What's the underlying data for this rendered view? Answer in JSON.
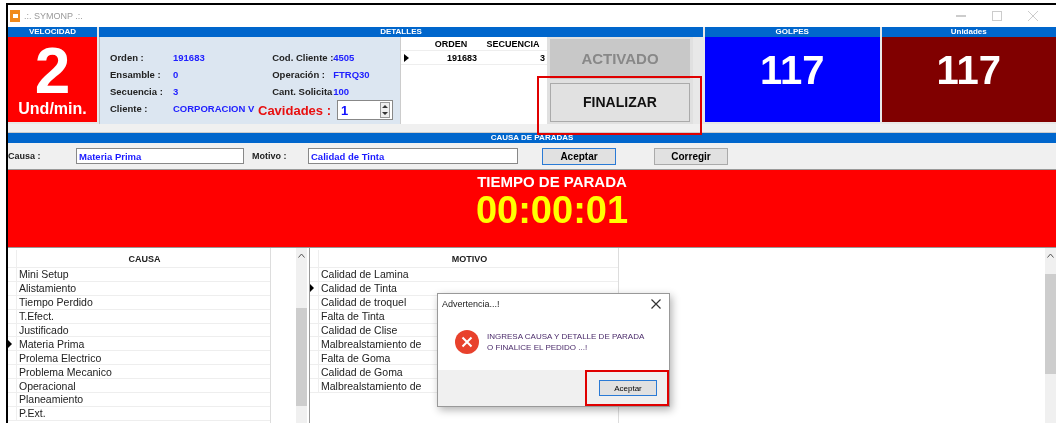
{
  "window": {
    "title": ".:. SYMONP .:."
  },
  "velocidad": {
    "header": "VELOCIDAD",
    "value": "2",
    "unit": "Und/min."
  },
  "detalles": {
    "header": "DETALLES",
    "left_fields": [
      {
        "label": "Orden :",
        "value": "191683"
      },
      {
        "label": "Ensamble :",
        "value": "0"
      },
      {
        "label": "Secuencia :",
        "value": "3"
      },
      {
        "label": "Cliente :",
        "value": "CORPORACION V"
      }
    ],
    "right_fields": [
      {
        "label": "Cod. Cliente :",
        "value": "4505"
      },
      {
        "label": "Operación :",
        "value": "FTRQ30"
      },
      {
        "label": "Cant. Solicita",
        "value": "100"
      }
    ],
    "cavidades": {
      "label": "Cavidades :",
      "value": "1"
    },
    "grid": {
      "columns": [
        "ORDEN",
        "SECUENCIA"
      ],
      "rows": [
        {
          "cells": [
            "191683",
            "3"
          ],
          "selected": true
        }
      ]
    },
    "buttons": [
      {
        "label": "ACTIVADO",
        "disabled": true,
        "highlighted": false
      },
      {
        "label": "FINALIZAR",
        "disabled": false,
        "highlighted": true
      }
    ]
  },
  "golpes": {
    "header": "GOLPES",
    "value": "117"
  },
  "unidades": {
    "header": "Unidades",
    "value": "117"
  },
  "causa_de_paradas": {
    "header": "CAUSA DE PARADAS",
    "causa": {
      "label": "Causa :",
      "value": "Materia Prima"
    },
    "motivo": {
      "label": "Motivo :",
      "value": "Calidad de Tinta"
    },
    "buttons": [
      {
        "label": "Aceptar",
        "default": true
      },
      {
        "label": "Corregir",
        "default": false
      }
    ]
  },
  "timer": {
    "title": "TIEMPO DE PARADA",
    "value": "00:00:01"
  },
  "causa_list": {
    "header": "CAUSA",
    "items": [
      {
        "label": "Mini Setup",
        "selected": false
      },
      {
        "label": "Alistamiento",
        "selected": false
      },
      {
        "label": "Tiempo Perdido",
        "selected": false
      },
      {
        "label": "T.Efect.",
        "selected": false
      },
      {
        "label": "Justificado",
        "selected": false
      },
      {
        "label": "Materia Prima",
        "selected": true
      },
      {
        "label": "Prolema Electrico",
        "selected": false
      },
      {
        "label": "Problema Mecanico",
        "selected": false
      },
      {
        "label": "Operacional",
        "selected": false
      },
      {
        "label": "Planeamiento",
        "selected": false
      },
      {
        "label": "P.Ext.",
        "selected": false
      }
    ]
  },
  "motivo_list": {
    "header": "MOTIVO",
    "items": [
      {
        "label": "Calidad de Lamina",
        "selected": false
      },
      {
        "label": "Calidad de Tinta",
        "selected": true
      },
      {
        "label": "Calidad de troquel",
        "selected": false
      },
      {
        "label": "Falta de Tinta",
        "selected": false
      },
      {
        "label": "Calidad de Clise",
        "selected": false
      },
      {
        "label": "Malbrealstamiento de",
        "selected": false
      },
      {
        "label": "Falta de Goma",
        "selected": false
      },
      {
        "label": "Calidad de Goma",
        "selected": false
      },
      {
        "label": "Malbrealstamiento de",
        "selected": false
      }
    ]
  },
  "dialog": {
    "title": "Advertencia...!",
    "message": "INGRESA CAUSA Y DETALLE DE PARADA\nO FINALICE EL PEDIDO ...!",
    "button": {
      "label": "Aceptar",
      "highlighted": true
    }
  }
}
